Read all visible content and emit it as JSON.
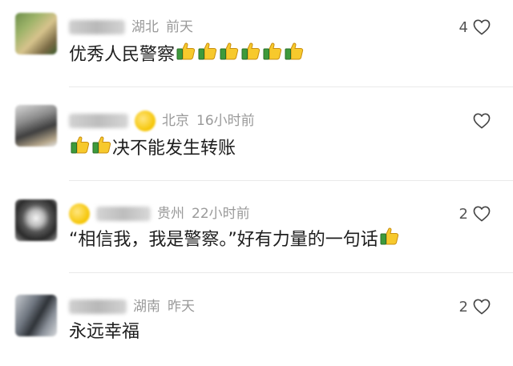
{
  "comments": [
    {
      "location": "湖北",
      "time": "前天",
      "text": "优秀人民警察",
      "likes": "4",
      "text_thumbs_after": 6,
      "text_thumbs_before": 0
    },
    {
      "location": "北京",
      "time": "16小时前",
      "text": "决不能发生转账",
      "likes": "",
      "text_thumbs_after": 0,
      "text_thumbs_before": 2
    },
    {
      "location": "贵州",
      "time": "22小时前",
      "text": "“相信我，我是警察。”好有力量的一句话",
      "likes": "2",
      "text_thumbs_after": 1,
      "text_thumbs_before": 0
    },
    {
      "location": "湖南",
      "time": "昨天",
      "text": "永远幸福",
      "likes": "2",
      "text_thumbs_after": 0,
      "text_thumbs_before": 0
    }
  ],
  "icons": {
    "like": "heart-icon",
    "emoji": "thumbs-up-emoji"
  },
  "colors": {
    "meta_gray": "#9a9a9a",
    "text": "#1e1e1e"
  }
}
